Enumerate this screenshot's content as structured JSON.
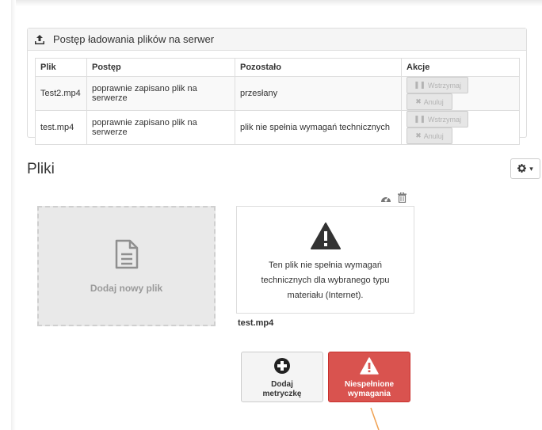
{
  "upload_panel": {
    "title": "Postęp ładowania plików na serwer",
    "columns": [
      "Plik",
      "Postęp",
      "Pozostało",
      "Akcje"
    ],
    "rows": [
      {
        "file": "Test2.mp4",
        "progress": "poprawnie zapisano plik na serwerze",
        "remaining": "przesłany"
      },
      {
        "file": "test.mp4",
        "progress": "poprawnie zapisano plik na serwerze",
        "remaining": "plik nie spełnia wymagań technicznych"
      }
    ],
    "hold_label": "Wstrzymaj",
    "cancel_label": "Anuluj"
  },
  "files": {
    "title": "Pliki",
    "add_file_label": "Dodaj nowy plik",
    "card": {
      "message": "Ten plik nie spełnia wymagań technicznych dla wybranego typu materiału (Internet).",
      "file_name": "test.mp4"
    },
    "add_metric_label": "Dodaj metryczkę",
    "requirements_label": "Niespełnione wymagania"
  },
  "colors": {
    "danger": "#d9534f",
    "annotation": "#f0a050"
  }
}
